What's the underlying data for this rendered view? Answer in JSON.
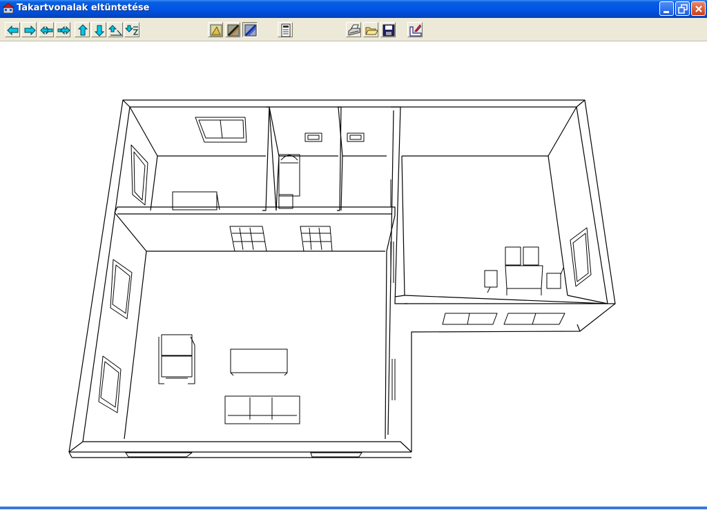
{
  "window": {
    "title": "Takartvonalak eltüntetése"
  },
  "titlebar_buttons": [
    {
      "name": "minimize-button",
      "icon": "minimize-icon"
    },
    {
      "name": "restore-button",
      "icon": "restore-icon"
    },
    {
      "name": "close-button",
      "icon": "close-icon"
    }
  ],
  "toolbar": {
    "buttons": [
      {
        "id": "pan-left",
        "icon": "arrow-left-icon"
      },
      {
        "id": "pan-right",
        "icon": "arrow-right-icon"
      },
      {
        "id": "rotate-left",
        "icon": "double-arrow-left-icon"
      },
      {
        "id": "rotate-right",
        "icon": "double-arrow-right-icon"
      },
      {
        "id": "move-up",
        "icon": "arrow-up-icon"
      },
      {
        "id": "move-down",
        "icon": "arrow-down-icon"
      },
      {
        "id": "tilt-up",
        "icon": "tilt-up-icon"
      },
      {
        "id": "tilt-down",
        "icon": "tilt-down-icon"
      },
      {
        "id": "view-mode-1",
        "icon": "render-plain-icon"
      },
      {
        "id": "view-mode-2",
        "icon": "render-hidden-icon"
      },
      {
        "id": "view-mode-3",
        "icon": "render-shaded-icon"
      },
      {
        "id": "calculator",
        "icon": "calculator-icon"
      },
      {
        "id": "print",
        "icon": "printer-icon"
      },
      {
        "id": "open",
        "icon": "folder-open-icon"
      },
      {
        "id": "save",
        "icon": "floppy-disk-icon"
      },
      {
        "id": "design",
        "icon": "drafting-tool-icon"
      }
    ]
  },
  "colors": {
    "title_bar": "#0055e5",
    "toolbar_bg": "#ece9d8",
    "arrow_icon": "#00c8e8",
    "canvas_bg": "#ffffff",
    "line": "#000000"
  }
}
